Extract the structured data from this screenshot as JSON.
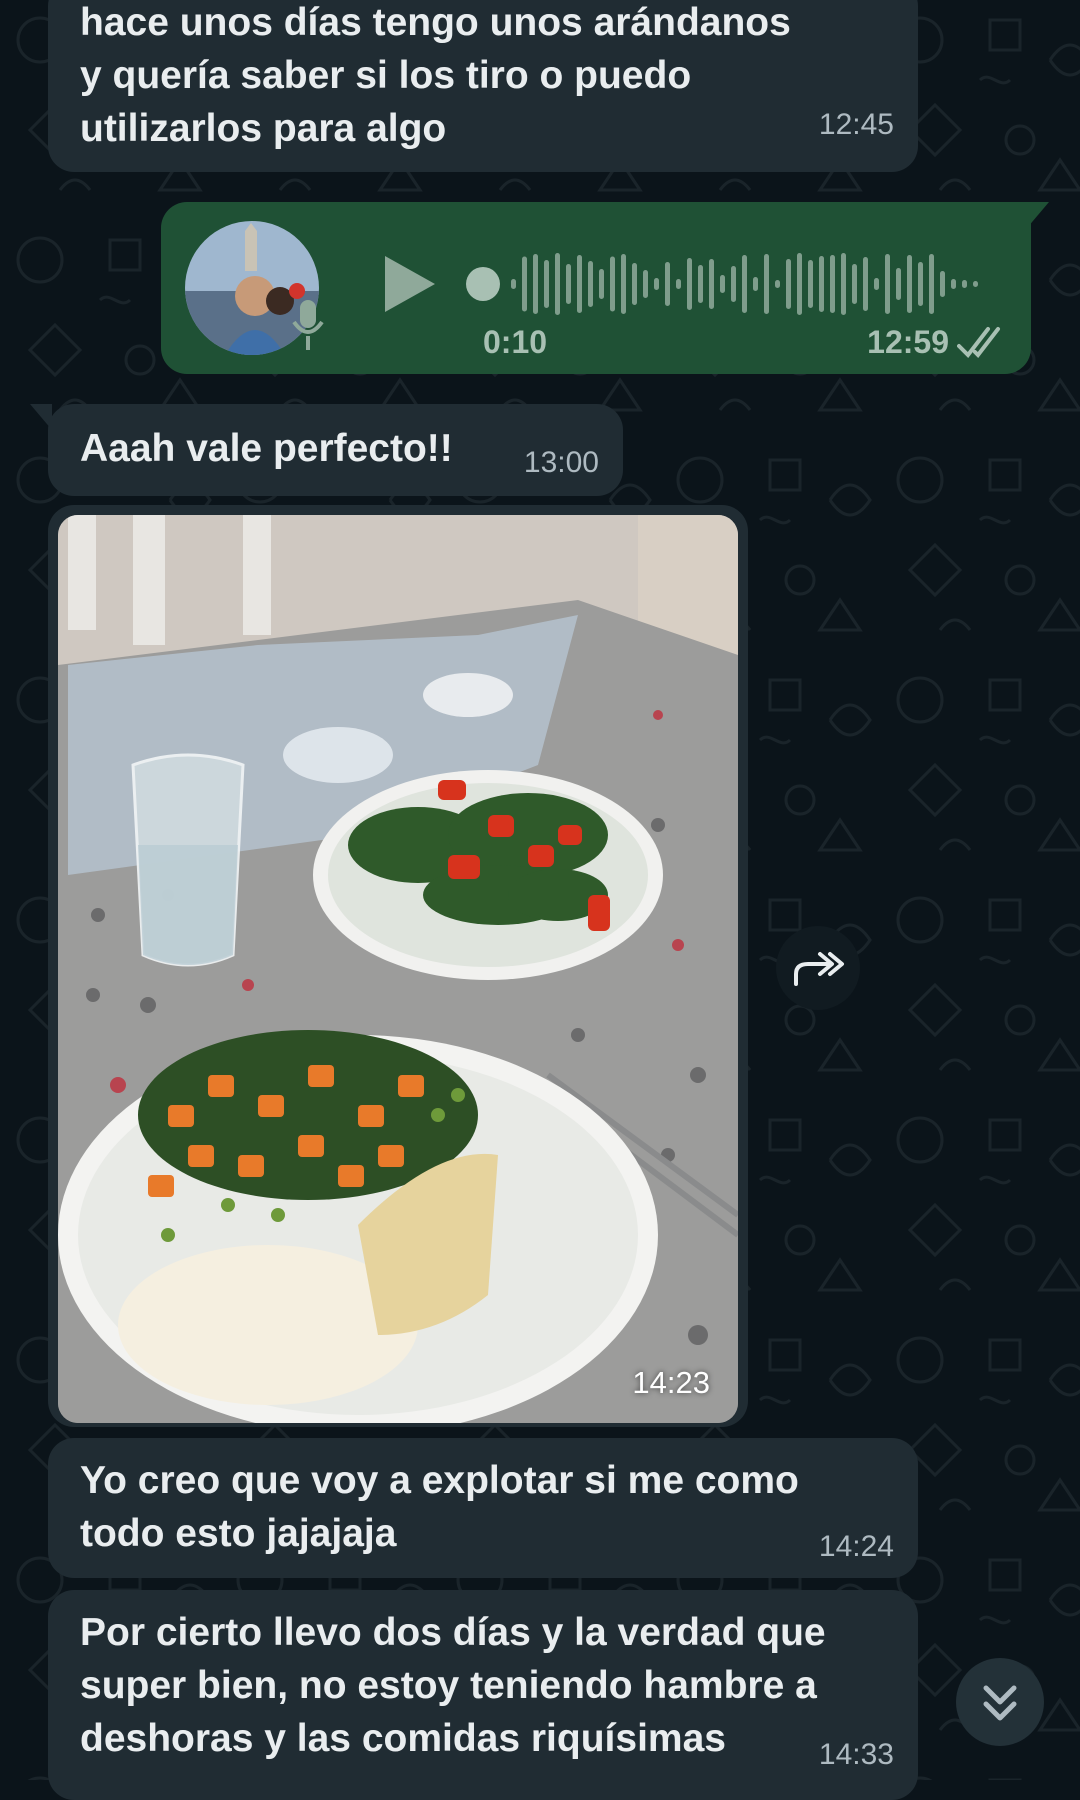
{
  "messages": [
    {
      "text": "hace unos días tengo unos arándanos\ny quería saber si los tiro o puedo\nutilizarlos para algo",
      "time": "12:45"
    },
    {
      "text": "Aaah vale perfecto!!",
      "time": "13:00"
    },
    {
      "text": "Yo creo que voy a explotar si me como\ntodo esto jajajaja",
      "time": "14:24"
    },
    {
      "text": "Por cierto llevo dos días y la verdad que\nsuper bien, no estoy teniendo hambre a\ndeshoras y las comidas riquísimas",
      "time": "14:33"
    }
  ],
  "voice_note": {
    "duration": "0:10",
    "time": "12:59",
    "status": "read",
    "icon": "play-icon"
  },
  "photo_message": {
    "time": "14:23",
    "icon": "forward-icon"
  },
  "scroll_button": {
    "icon": "double-chevron-down-icon"
  },
  "colors": {
    "background": "#0b141a",
    "incoming_bubble": "#202c33",
    "outgoing_bubble": "#1f5135",
    "timestamp": "#aebac1",
    "text": "#e9edef"
  }
}
